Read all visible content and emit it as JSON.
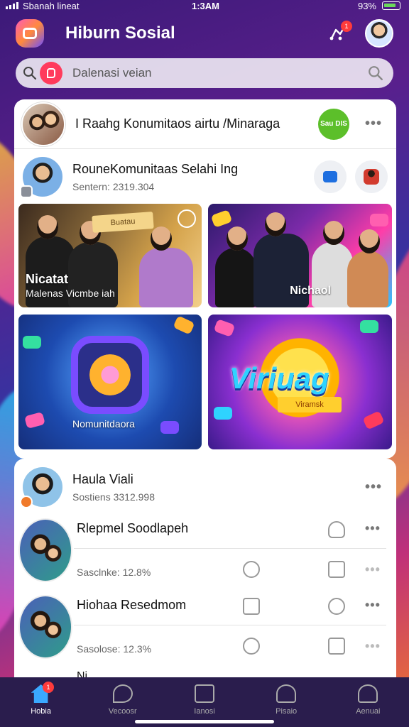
{
  "status_bar": {
    "carrier": "Sbanah lineat",
    "time": "1:3AM",
    "battery": "93%"
  },
  "header": {
    "title": "Hiburn Sosial",
    "notification_count": "1"
  },
  "search": {
    "placeholder": "Dalenasi veian"
  },
  "feed": {
    "row1": {
      "title": "I Raahg Konumitaos airtu /Minaraga",
      "badge": "Sau DIS"
    },
    "row2": {
      "title": "RouneKomunitaas Selahi Ing",
      "subtitle": "Sentern: 2319.304"
    },
    "tiles": [
      {
        "caption_a": "Nicatat",
        "caption_b": "Malenas Vicmbe iah",
        "sign": "Buatau"
      },
      {
        "caption": "Nichaol"
      },
      {
        "caption": "Nomunitdaora"
      },
      {
        "caption": "Viriuag",
        "ribbon": "Viramsk"
      }
    ]
  },
  "list": {
    "header": {
      "title": "Haula Viali",
      "subtitle": "Sostiens 3312.998"
    },
    "items": [
      {
        "title": "Rlepmel Soodlapeh",
        "subtitle": "Sasclnke: 12.8%"
      },
      {
        "title": "Hiohaa Resedmom",
        "subtitle": "Sasolose: 12.3%"
      }
    ],
    "partial_item": "Ni"
  },
  "bottom_nav": {
    "items": [
      {
        "label": "Hobia",
        "badge": "1"
      },
      {
        "label": "Vecoosr"
      },
      {
        "label": "Ianosi"
      },
      {
        "label": "Pisaio"
      },
      {
        "label": "Aenuai"
      }
    ]
  },
  "colors": {
    "accent": "#3aa8ff",
    "badge": "#ff3b3b",
    "nav_bg": "#2a1d4d",
    "green_badge": "#5cbf2a"
  },
  "icons": [
    "search-icon",
    "notification-icon",
    "more-icon",
    "person-icon",
    "chat-icon",
    "clipboard-icon",
    "home-icon"
  ]
}
